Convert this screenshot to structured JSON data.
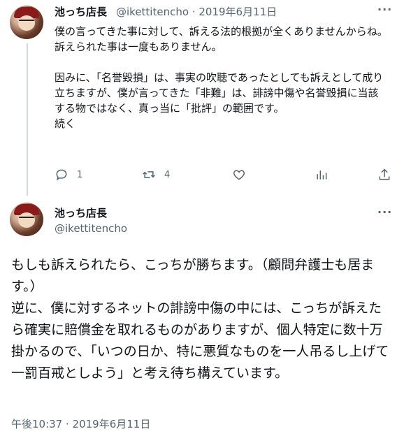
{
  "tweet1": {
    "name": "池っち店長",
    "handle": "@ikettitencho",
    "date": "2019年6月11日",
    "paragraphs": [
      "僕の言ってきた事に対して、訴える法的根拠が全くありませんからね。訴えられた事は一度もありません。",
      "因みに、「名誉毀損」は、事実の吹聴であったとしても訴えとして成り立ちますが、僕が言ってきた「非難」は、誹謗中傷や名誉毀損に当該する物ではなく、真っ当に「批評」の範囲です。",
      "続く"
    ],
    "reply_count": "1",
    "retweet_count": "4"
  },
  "tweet2": {
    "name": "池っち店長",
    "handle": "@ikettitencho",
    "paragraphs": [
      "もしも訴えられたら、こっちが勝ちます。（顧問弁護士も居ます。）",
      "逆に、僕に対するネットの誹謗中傷の中には、こっちが訴えたら確実に賠償金を取れるものがありますが、個人特定に数十万掛かるので、「いつの日か、特に悪質なものを一人吊るし上げて一罰百戒としよう」と考え待ち構えています。"
    ],
    "timestamp": "午後10:37 · 2019年6月11日"
  },
  "icons": {
    "more": "more-icon",
    "reply": "reply-icon",
    "retweet": "retweet-icon",
    "like": "like-icon",
    "views": "views-icon",
    "share": "share-icon"
  },
  "colors": {
    "text": "#0f1419",
    "secondary": "#536471",
    "thread_line": "#cfd9de"
  }
}
